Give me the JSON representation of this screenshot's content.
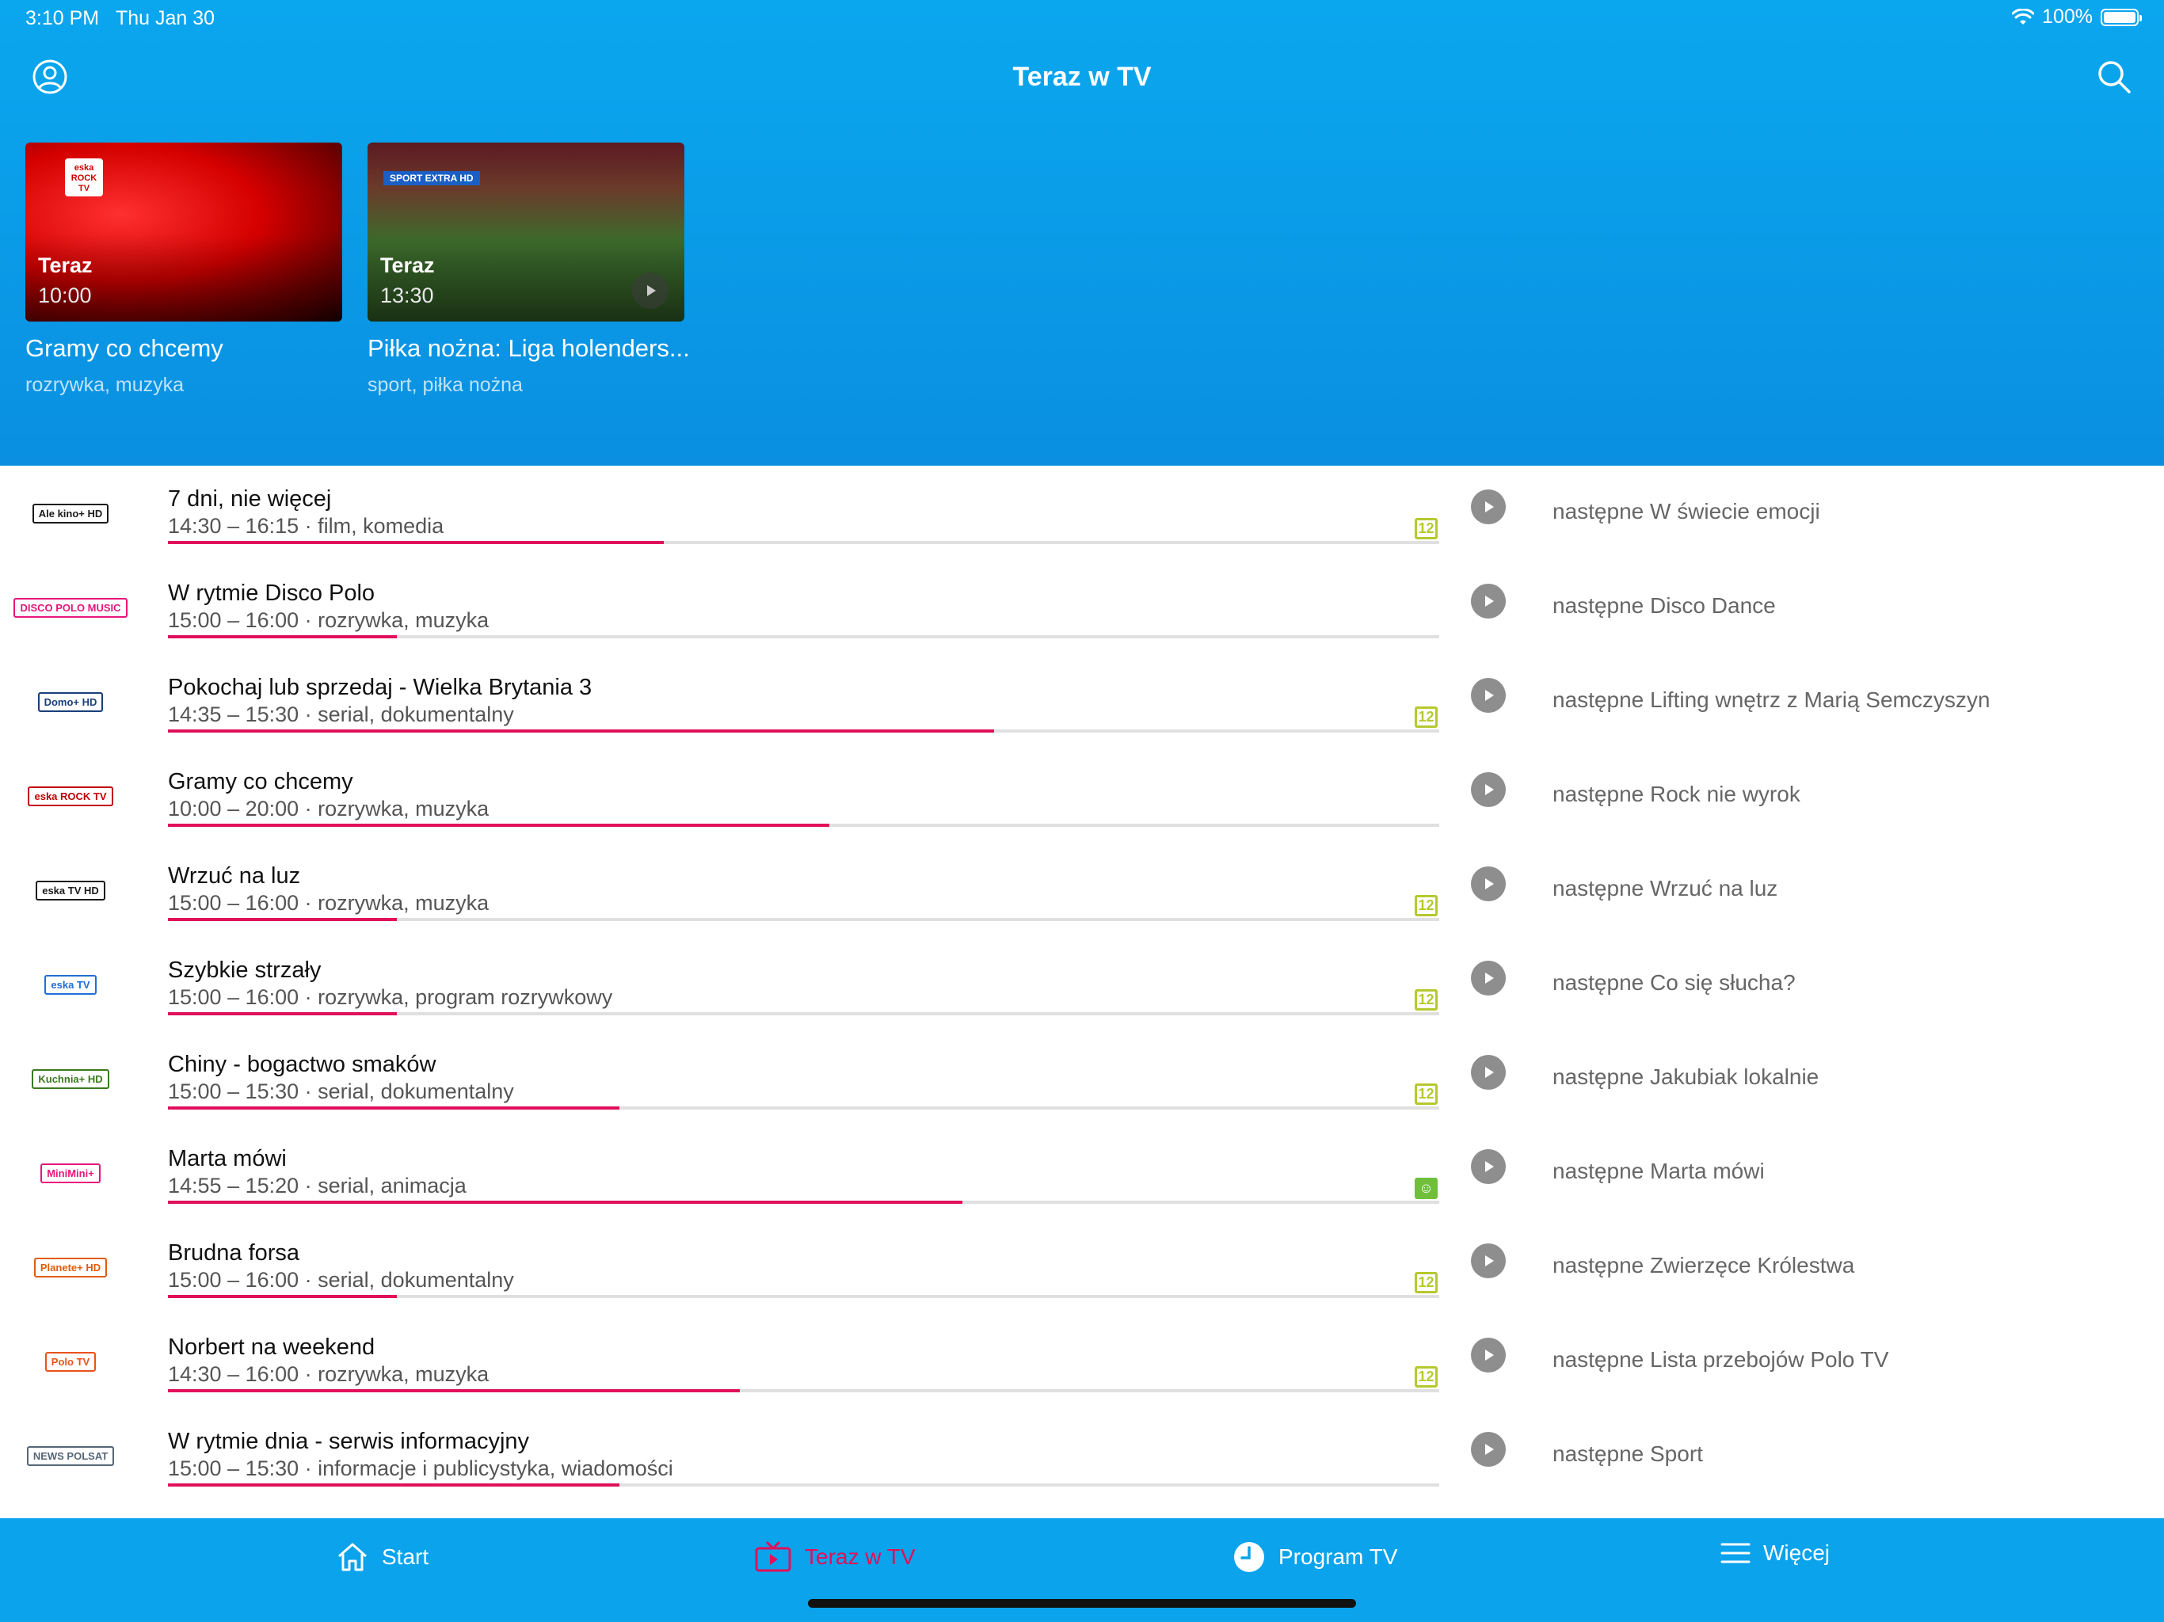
{
  "status_bar": {
    "time": "3:10 PM",
    "date": "Thu Jan 30",
    "battery": "100%"
  },
  "header": {
    "title": "Teraz w TV"
  },
  "featured": [
    {
      "channel_logo": "eska ROCK TV",
      "now_label": "Teraz",
      "time": "10:00",
      "title": "Gramy co chcemy",
      "genre": "rozrywka, muzyka"
    },
    {
      "channel_logo": "SPORT EXTRA HD",
      "now_label": "Teraz",
      "time": "13:30",
      "title": "Piłka nożna: Liga holenders...",
      "genre": "sport, piłka nożna"
    }
  ],
  "channels": [
    {
      "logo": "Ale kino+ HD",
      "logo_color": "#1a1a1a",
      "title": "7 dni, nie więcej",
      "meta": "14:30 – 16:15 · film, komedia",
      "progress": 0.39,
      "rating": "12",
      "next": "następne W świecie emocji"
    },
    {
      "logo": "DISCO POLO MUSIC",
      "logo_color": "#e8157a",
      "title": "W rytmie Disco Polo",
      "meta": "15:00 – 16:00 · rozrywka, muzyka",
      "progress": 0.18,
      "rating": "",
      "next": "następne Disco Dance"
    },
    {
      "logo": "Domo+ HD",
      "logo_color": "#1a3f7a",
      "title": "Pokochaj lub sprzedaj - Wielka Brytania 3",
      "meta": "14:35 – 15:30 · serial, dokumentalny",
      "progress": 0.65,
      "rating": "12",
      "next": "następne Lifting wnętrz z Marią Semczyszyn"
    },
    {
      "logo": "eska ROCK TV",
      "logo_color": "#c00000",
      "title": "Gramy co chcemy",
      "meta": "10:00 – 20:00 · rozrywka, muzyka",
      "progress": 0.52,
      "rating": "",
      "next": "następne Rock nie wyrok"
    },
    {
      "logo": "eska TV HD",
      "logo_color": "#1a1a1a",
      "title": "Wrzuć na luz",
      "meta": "15:00 – 16:00 · rozrywka, muzyka",
      "progress": 0.18,
      "rating": "12",
      "next": "następne Wrzuć na luz"
    },
    {
      "logo": "eska TV",
      "logo_color": "#1f6fd6",
      "title": "Szybkie strzały",
      "meta": "15:00 – 16:00 · rozrywka, program rozrywkowy",
      "progress": 0.18,
      "rating": "12",
      "next": "następne Co się słucha?"
    },
    {
      "logo": "Kuchnia+ HD",
      "logo_color": "#3a7a1e",
      "title": "Chiny - bogactwo smaków",
      "meta": "15:00 – 15:30 · serial, dokumentalny",
      "progress": 0.355,
      "rating": "12",
      "next": "następne Jakubiak lokalnie"
    },
    {
      "logo": "MiniMini+",
      "logo_color": "#e8157a",
      "title": "Marta mówi",
      "meta": "14:55 – 15:20 · serial, animacja",
      "progress": 0.625,
      "rating": "smile",
      "next": "następne Marta mówi"
    },
    {
      "logo": "Planete+ HD",
      "logo_color": "#e25b10",
      "title": "Brudna forsa",
      "meta": "15:00 – 16:00 · serial, dokumentalny",
      "progress": 0.18,
      "rating": "12",
      "next": "następne Zwierzęce Królestwa"
    },
    {
      "logo": "Polo TV",
      "logo_color": "#e8521a",
      "title": "Norbert na weekend",
      "meta": "14:30 – 16:00 · rozrywka, muzyka",
      "progress": 0.45,
      "rating": "12",
      "next": "następne Lista przebojów Polo TV"
    },
    {
      "logo": "NEWS POLSAT",
      "logo_color": "#556677",
      "title": "W rytmie dnia - serwis informacyjny",
      "meta": "15:00 – 15:30 · informacje i publicystyka, wiadomości",
      "progress": 0.355,
      "rating": "",
      "next": "następne Sport"
    }
  ],
  "tab_bar": {
    "tabs": [
      {
        "label": "Start",
        "icon": "home-icon",
        "active": false
      },
      {
        "label": "Teraz w TV",
        "icon": "tv-icon",
        "active": true
      },
      {
        "label": "Program TV",
        "icon": "clock-icon",
        "active": false
      },
      {
        "label": "Więcej",
        "icon": "menu-icon",
        "active": false
      }
    ]
  },
  "colors": {
    "brand_blue": "#0aa3ec",
    "accent_pink": "#e0105a",
    "rating_green": "#b5c92f"
  }
}
